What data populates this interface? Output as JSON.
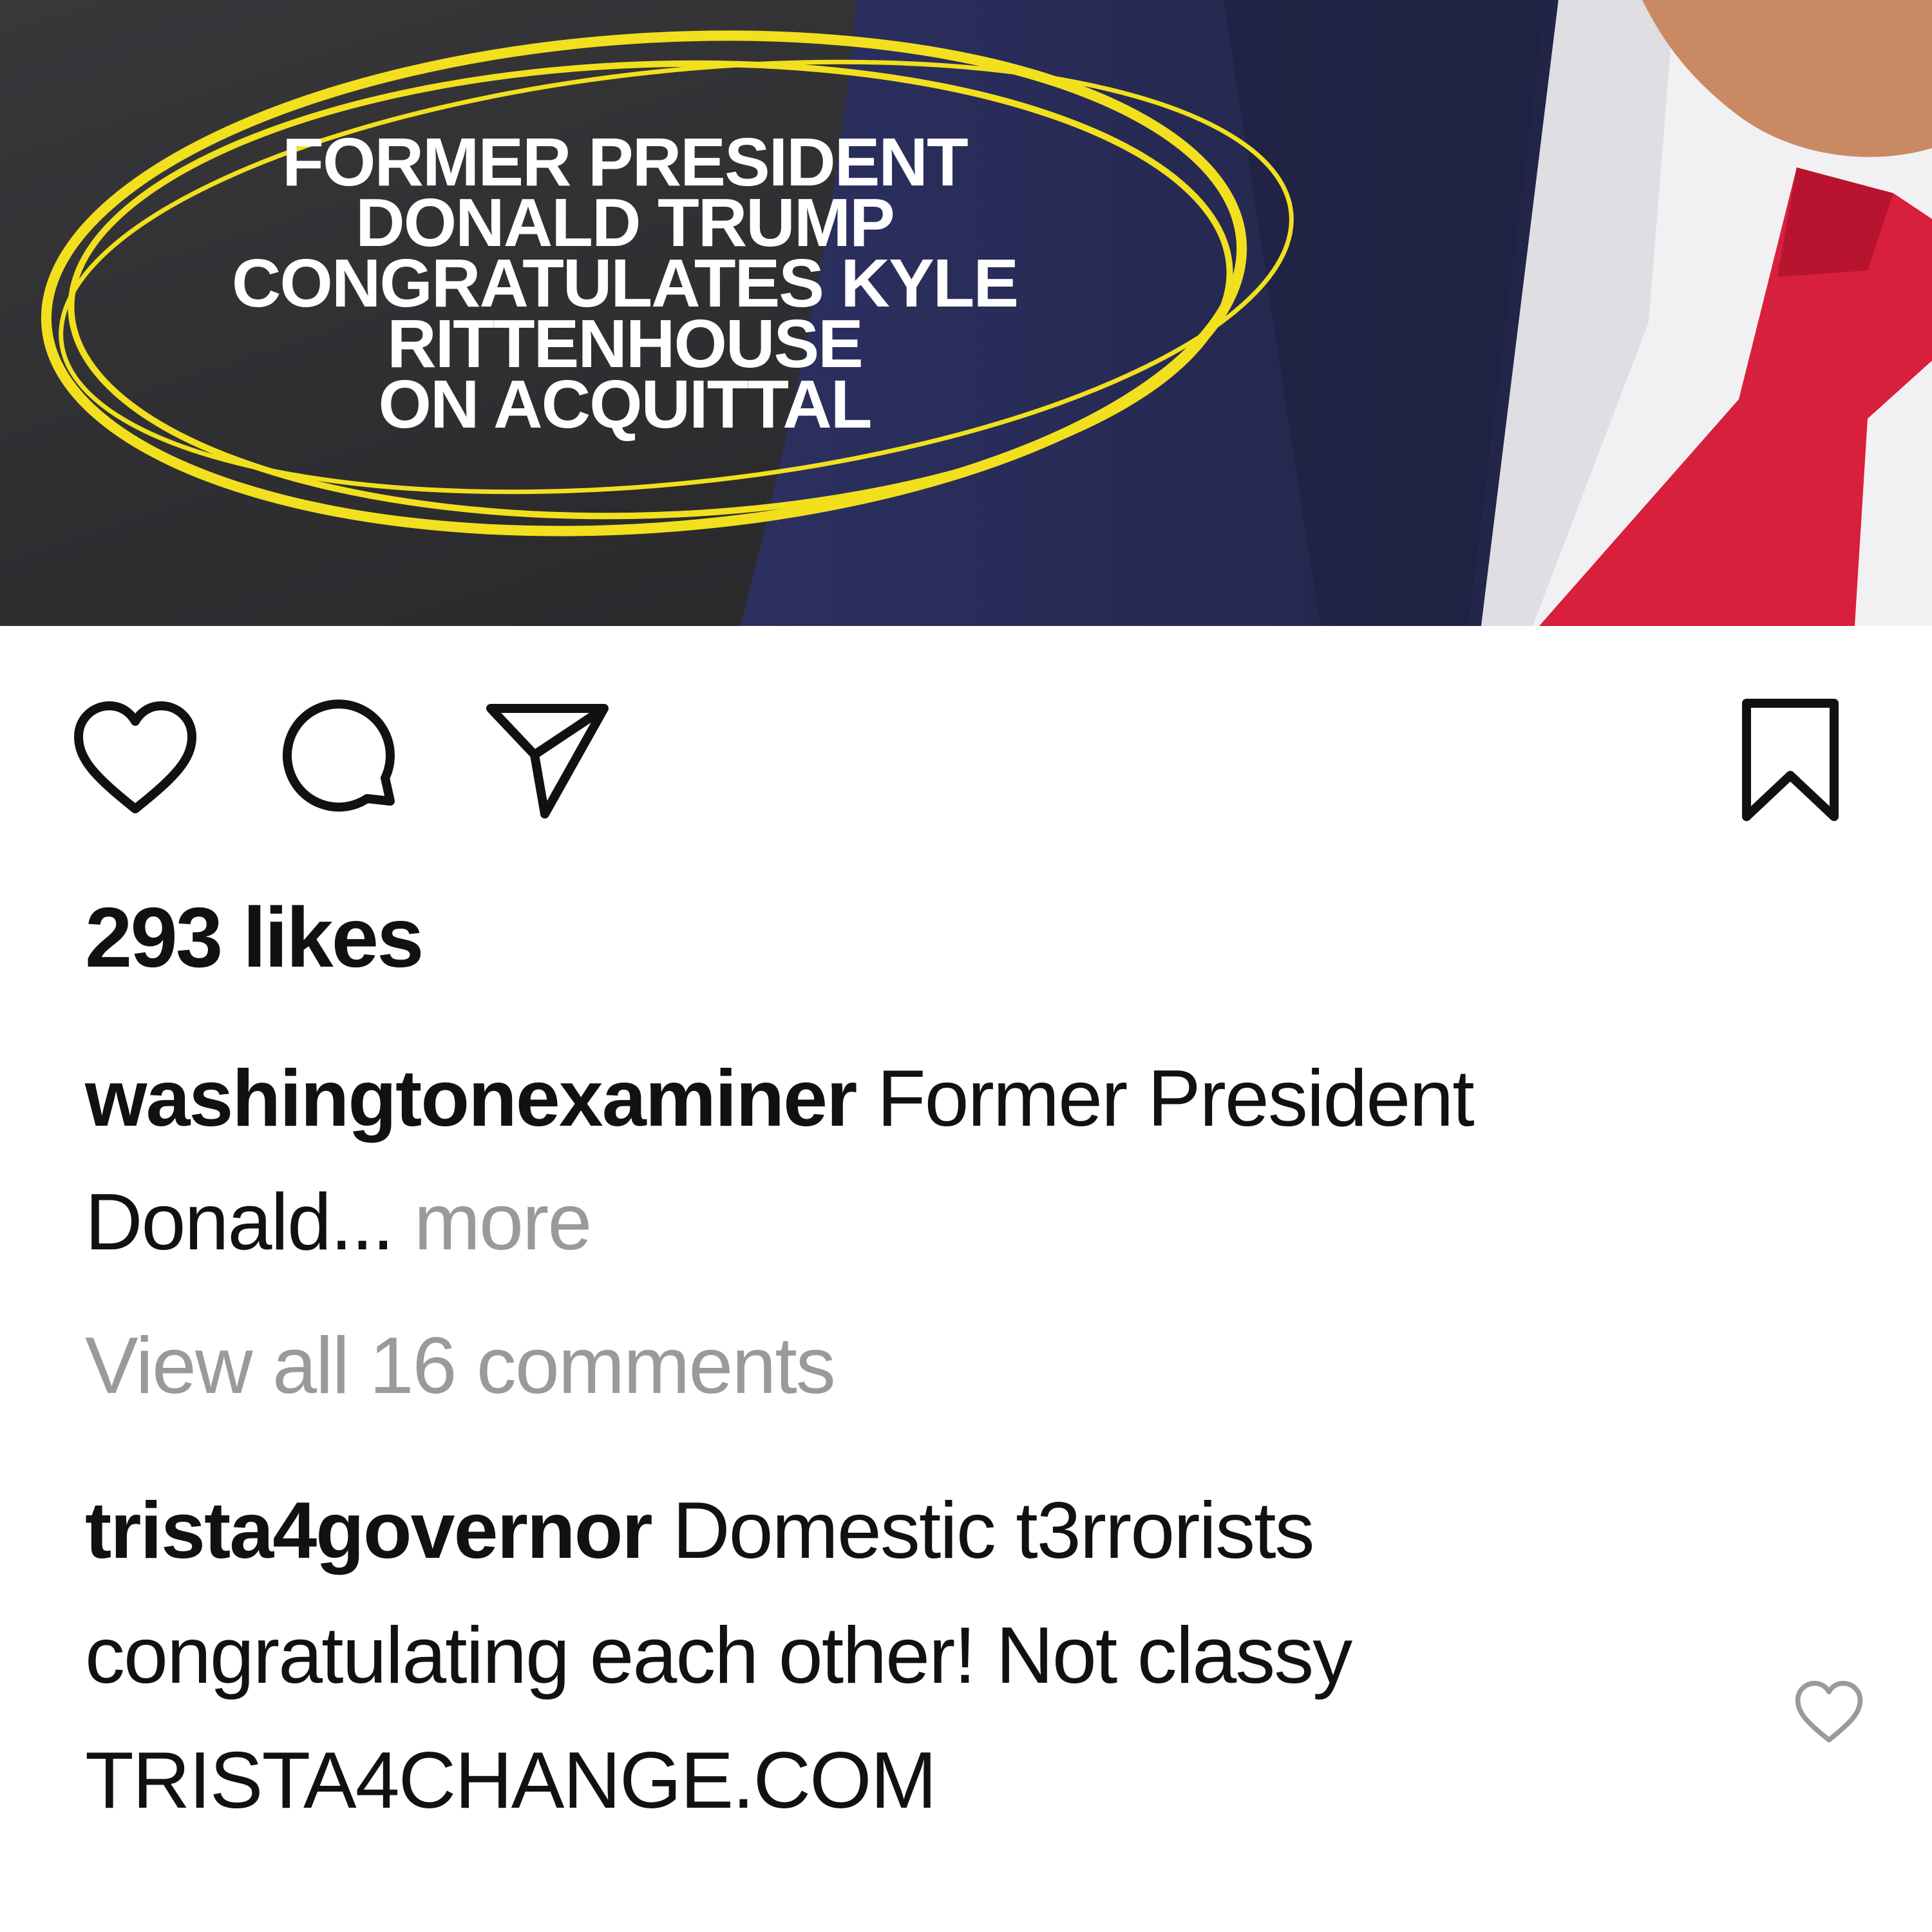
{
  "post": {
    "image_overlay_lines": [
      "FORMER PRESIDENT",
      "DONALD TRUMP",
      "CONGRATULATES KYLE",
      "RITTENHOUSE",
      "ON ACQUITTAL"
    ]
  },
  "actions": {
    "like_icon": "heart-icon",
    "comment_icon": "comment-bubble-icon",
    "share_icon": "paper-plane-icon",
    "save_icon": "bookmark-icon"
  },
  "likes_text": "293 likes",
  "caption": {
    "username": "washingtonexaminer",
    "text": "Former President Donald...",
    "more_label": "more"
  },
  "view_comments_label": "View all 16 comments",
  "comment": {
    "username": "trista4governor",
    "text": "Domestic t3rrorists congratulating each other! Not classy TRISTA4CHANGE.COM",
    "like_icon": "heart-outline-icon"
  },
  "colors": {
    "text": "#111111",
    "muted": "#9a9a9a",
    "highlight_ring": "#f2e01e",
    "tie": "#d81f3c",
    "suit": "#262a4e"
  }
}
